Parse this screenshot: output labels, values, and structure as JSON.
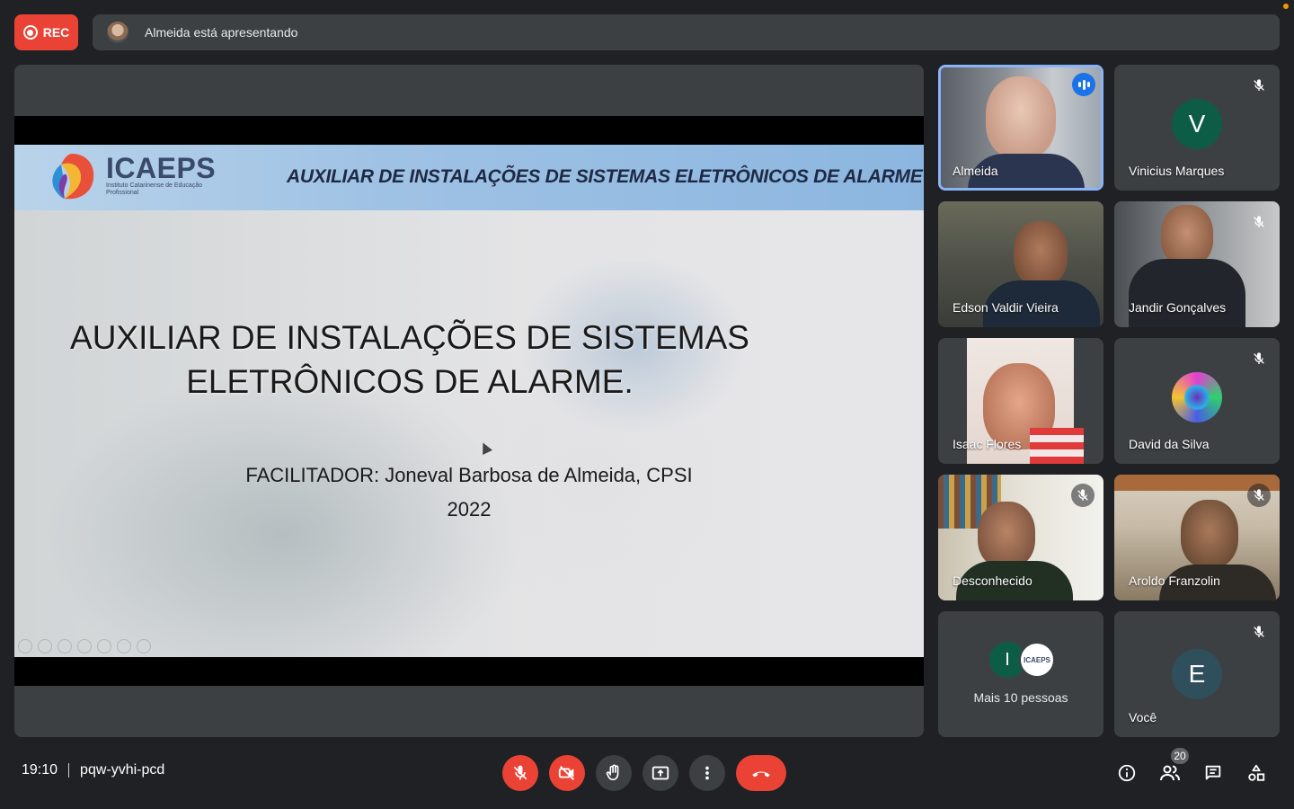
{
  "recording": {
    "label": "REC"
  },
  "presenting": {
    "text": "Almeida está apresentando"
  },
  "slide": {
    "brand": "ICAEPS",
    "brand_sub": "Instituto Catarinense de Educação Profissional",
    "header_title": "AUXILIAR DE INSTALAÇÕES DE SISTEMAS ELETRÔNICOS DE ALARME",
    "title_line1": "AUXILIAR DE INSTALAÇÕES DE SISTEMAS",
    "title_line2": "ELETRÔNICOS DE ALARME.",
    "facilitator": "FACILITADOR: Joneval Barbosa de Almeida, CPSI",
    "year": "2022"
  },
  "participants": [
    {
      "name": "Almeida",
      "state": "speaking"
    },
    {
      "name": "Vinicius Marques",
      "avatar_letter": "V",
      "avatar_color": "#0d5c45",
      "muted": true
    },
    {
      "name": "Edson Valdir Vieira"
    },
    {
      "name": "Jandir Gonçalves",
      "muted": true
    },
    {
      "name": "Isaac Flores"
    },
    {
      "name": "David da Silva",
      "muted": true
    },
    {
      "name": "Desconhecido",
      "muted": true
    },
    {
      "name": "Aroldo Franzolin",
      "muted": true
    },
    {
      "name": "Mais 10 pessoas",
      "avatar_letter": "I",
      "avatar_color": "#0d5c45",
      "badge_text": "ICAEPS"
    },
    {
      "name": "Você",
      "avatar_letter": "E",
      "avatar_color": "#2f4f5c",
      "muted": true
    }
  ],
  "meeting": {
    "time": "19:10",
    "code": "pqw-yvhi-pcd"
  },
  "people_count": "20",
  "icons": {
    "mic": "mic-off-icon",
    "camera": "camera-off-icon",
    "hand": "raise-hand-icon",
    "present": "present-icon",
    "more": "more-options-icon",
    "leave": "leave-call-icon",
    "info": "info-icon",
    "people": "people-icon",
    "chat": "chat-icon",
    "activities": "activities-icon"
  },
  "colors": {
    "accent_red": "#ea4335",
    "speaking_blue": "#1a73e8",
    "active_border": "#8ab4f8",
    "surface": "#3c4043",
    "background": "#202124"
  }
}
